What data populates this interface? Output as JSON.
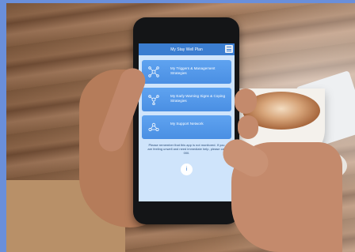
{
  "app": {
    "title": "My Stay Well Plan"
  },
  "menu": {
    "icon": "hamburger-menu-icon"
  },
  "cards": [
    {
      "label": "My Triggers & Management Strategies",
      "icon": "triggers-network-icon"
    },
    {
      "label": "My Early Warning Signs & Coping Strategies",
      "icon": "warning-network-icon"
    },
    {
      "label": "My Support Network",
      "icon": "support-network-icon"
    }
  ],
  "info": {
    "text": "Please remember that this app is not monitored. If you are feeling unwell and need immediate help, please call 000.",
    "icon": "info-icon"
  },
  "colors": {
    "topbar": "#3b7dd0",
    "card": "#4a8fe3",
    "screen_bg": "#cfe4fb",
    "frame": "#6a8fda"
  }
}
